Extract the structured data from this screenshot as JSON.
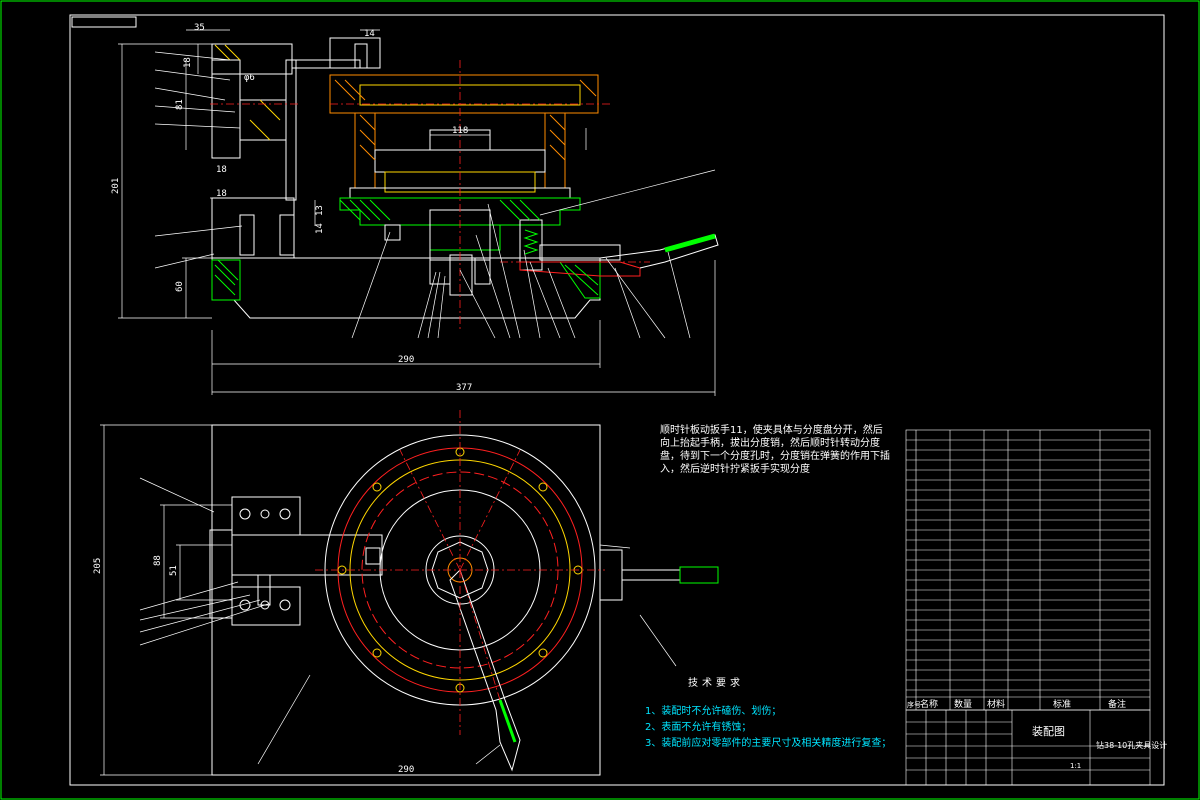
{
  "dimensions": {
    "d35": "35",
    "d14": "14",
    "d18a": "18",
    "d81": "81",
    "d6": "φ6",
    "d201": "201",
    "d18b": "18",
    "d18c": "18",
    "d60": "60",
    "d13": "13",
    "d14b": "14",
    "d118": "118",
    "d290a": "290",
    "d377": "377",
    "d205": "205",
    "d88": "88",
    "d51": "51",
    "d290b": "290"
  },
  "operation_note": "顺时针板动扳手11，使夹具体与分度盘分开，然后向上抬起手柄，拔出分度销，然后顺时针转动分度盘，待到下一个分度孔时，分度销在弹簧的作用下插入，然后逆时针拧紧扳手实现分度",
  "tech_requirements": {
    "title": "技术要求",
    "items": [
      "1、装配时不允许磕伤、划伤；",
      "2、表面不允许有锈蚀；",
      "3、装配前应对零部件的主要尺寸及相关精度进行复查；"
    ]
  },
  "title_block": {
    "drawing_name": "装配图",
    "part_title": "钻38-10孔夹具设计",
    "scale": "1:1",
    "bom_headers": [
      "序号",
      "名称",
      "数量",
      "材料",
      "标准",
      "备注"
    ]
  },
  "colors": {
    "border": "#00ff00",
    "outline": "#ffffff",
    "centerline": "#ff2020",
    "hatch": "#ffd700",
    "section": "#ff8c00",
    "spring": "#00ff00",
    "cyan": "#00e5ff"
  }
}
